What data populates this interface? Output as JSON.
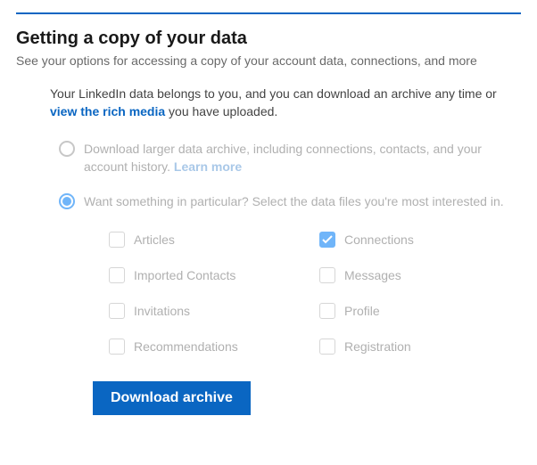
{
  "header": {
    "title": "Getting a copy of your data",
    "subtitle": "See your options for accessing a copy of your account data, connections, and more"
  },
  "intro": {
    "prefix": "Your LinkedIn data belongs to you, and you can download an archive any time or ",
    "link": "view the rich media",
    "suffix": " you have uploaded."
  },
  "option_full": {
    "text": "Download larger data archive, including connections, contacts, and your account history. ",
    "learn_more": "Learn more",
    "selected": false
  },
  "option_partial": {
    "text": "Want something in particular? Select the data files you're most interested in.",
    "selected": true
  },
  "files": [
    {
      "label": "Articles",
      "checked": false
    },
    {
      "label": "Connections",
      "checked": true
    },
    {
      "label": "Imported Contacts",
      "checked": false
    },
    {
      "label": "Messages",
      "checked": false
    },
    {
      "label": "Invitations",
      "checked": false
    },
    {
      "label": "Profile",
      "checked": false
    },
    {
      "label": "Recommendations",
      "checked": false
    },
    {
      "label": "Registration",
      "checked": false
    }
  ],
  "actions": {
    "download": "Download archive"
  },
  "colors": {
    "accent": "#0a66c2",
    "accent_light": "#70b5f9"
  }
}
